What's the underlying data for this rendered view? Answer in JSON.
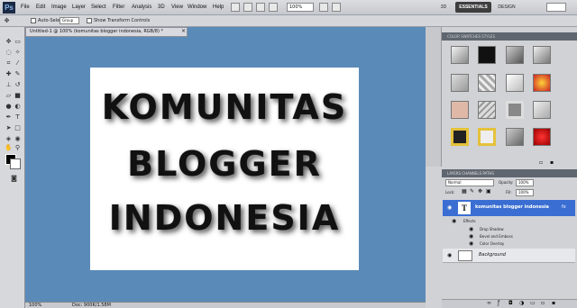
{
  "app": {
    "logo": "Ps"
  },
  "menu": [
    "File",
    "Edit",
    "Image",
    "Layer",
    "Select",
    "Filter",
    "Analysis",
    "3D",
    "View",
    "Window",
    "Help"
  ],
  "topbar": {
    "zoom": "100%",
    "workspaces": [
      "3D",
      "ESSENTIALS",
      "DESIGN"
    ]
  },
  "options": {
    "auto_select_label": "Auto-Select",
    "auto_select_value": "Group",
    "transform_label": "Show Transform Controls"
  },
  "document": {
    "tab_title": "Untitled-1 @ 100% (komunitas blogger indonesia, RGB/8) *",
    "close": "×"
  },
  "canvas_text": [
    "KOMUNITAS",
    "BLOGGER",
    "INDONESIA"
  ],
  "status": {
    "zoom": "100%",
    "doc": "Doc: 900K/1.58M"
  },
  "panels": {
    "styles_tabs": "COLOR   SWATCHES   STYLES",
    "layers_tabs": "LAYERS   CHANNELS   PATHS",
    "blend_mode": "Normal",
    "opacity_label": "Opacity:",
    "opacity_value": "100%",
    "fill_label": "Fill:",
    "fill_value": "100%",
    "lock_label": "Lock:"
  },
  "layers": {
    "text_layer": "komunitas blogger indonesia",
    "fx_symbol": "fx",
    "effects": "Effects",
    "effect_items": [
      "Drop Shadow",
      "Bevel and Emboss",
      "Color Overlay"
    ],
    "background": "Background"
  },
  "colors": {
    "canvas_bg": "#5a8ab8",
    "layer_selected": "#3a6ed2"
  }
}
